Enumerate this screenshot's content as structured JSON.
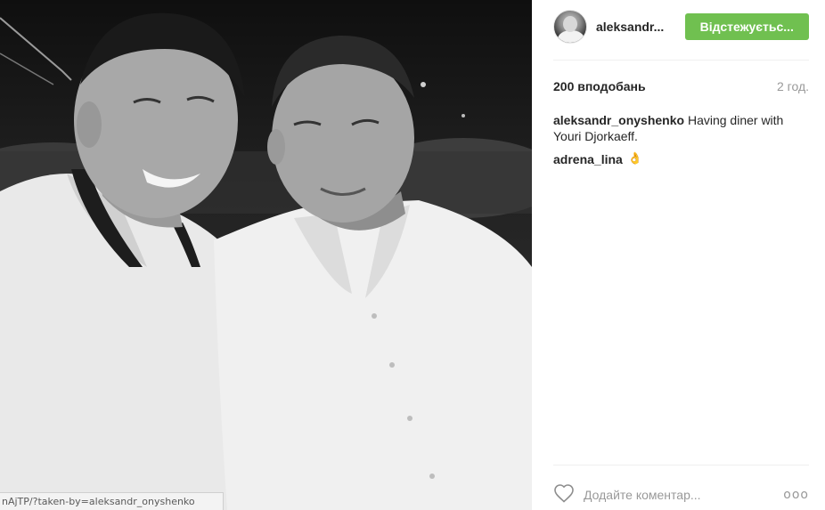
{
  "post": {
    "username": "aleksandr...",
    "follow_label": "Відстежуєтьс...",
    "likes": "200 вподобань",
    "time": "2 год.",
    "caption_user": "aleksandr_onyshenko",
    "caption_text": "Having diner with Youri Djorkaeff.",
    "comment_user": "adrena_lina",
    "comment_emoji": "👌",
    "add_comment_placeholder": "Додайте коментар...",
    "more_options": "ooo"
  },
  "browser": {
    "status_url": "nAjTP/?taken-by=aleksandr_onyshenko"
  },
  "icons": {
    "like": "heart-icon",
    "more": "more-options-icon"
  },
  "colors": {
    "follow_button": "#70c050",
    "secondary_text": "#999999"
  }
}
